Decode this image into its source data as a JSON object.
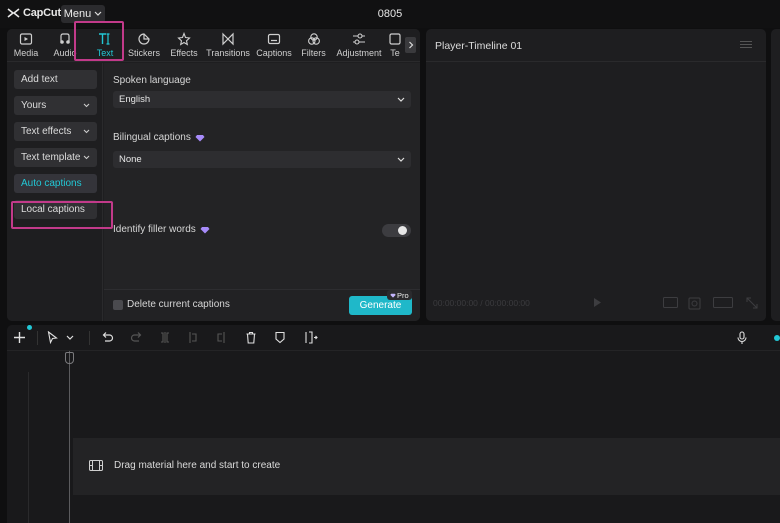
{
  "app": {
    "logo_text": "CapCut",
    "menu_label": "Menu",
    "project_name": "0805"
  },
  "tabs": [
    {
      "label": "Media",
      "icon": "media-icon"
    },
    {
      "label": "Audio",
      "icon": "audio-icon"
    },
    {
      "label": "Text",
      "icon": "text-icon",
      "active": true
    },
    {
      "label": "Stickers",
      "icon": "stickers-icon"
    },
    {
      "label": "Effects",
      "icon": "effects-icon"
    },
    {
      "label": "Transitions",
      "icon": "transitions-icon"
    },
    {
      "label": "Captions",
      "icon": "captions-icon"
    },
    {
      "label": "Filters",
      "icon": "filters-icon"
    },
    {
      "label": "Adjustment",
      "icon": "adjustment-icon"
    },
    {
      "label": "Te",
      "icon": "templates-icon"
    }
  ],
  "sidebar": {
    "items": [
      {
        "label": "Add text",
        "chevron": false
      },
      {
        "label": "Yours",
        "chevron": true
      },
      {
        "label": "Text effects",
        "chevron": true
      },
      {
        "label": "Text template",
        "chevron": true
      },
      {
        "label": "Auto captions",
        "chevron": false,
        "active": true
      },
      {
        "label": "Local captions",
        "chevron": false
      }
    ]
  },
  "captions": {
    "spoken_language_label": "Spoken language",
    "spoken_language_value": "English",
    "bilingual_label": "Bilingual captions",
    "bilingual_value": "None",
    "filler_label": "Identify filler words",
    "filler_enabled": false,
    "delete_label": "Delete current captions",
    "delete_checked": false,
    "generate_label": "Generate",
    "pro_label": "Pro"
  },
  "player": {
    "title": "Player-Timeline 01",
    "time": "00:00:00:00 / 00:00:00:00"
  },
  "timeline": {
    "drop_hint": "Drag material here and start to create"
  },
  "colors": {
    "accent": "#22c8d6",
    "highlight": "#c23a8a",
    "generate": "#1fb8c9"
  }
}
